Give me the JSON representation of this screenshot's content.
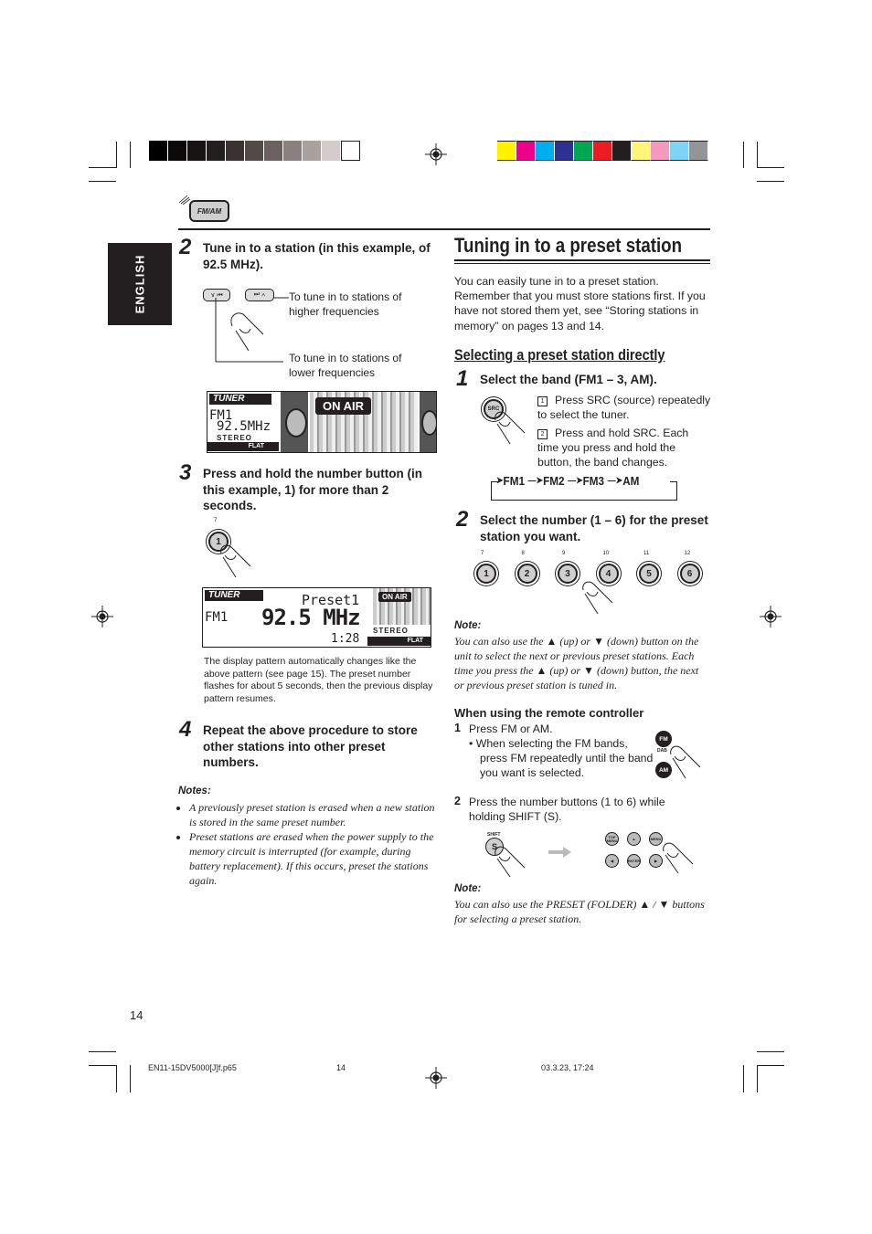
{
  "print_marks": {
    "grayscale_swatches": [
      "#000000",
      "#0b0908",
      "#171312",
      "#231f1e",
      "#3a3331",
      "#524a47",
      "#6b625f",
      "#8a817e",
      "#a9a19e",
      "#d3cccb",
      "#ffffff"
    ],
    "color_swatches": [
      "#fff200",
      "#ec008c",
      "#00aeef",
      "#2e3192",
      "#00a651",
      "#ed1c24",
      "#231f20",
      "#fff57a",
      "#f49ac1",
      "#7fd3f7",
      "#939598"
    ]
  },
  "side_tab": {
    "label": "ENGLISH"
  },
  "left": {
    "fm_am_button_label": "FM/AM",
    "step2": {
      "number": "2",
      "text": "Tune in to a station (in this example, of 92.5 MHz).",
      "button_down_label": "∨ ⏮",
      "button_up_label": "⏭ ∧",
      "higher_label": "To tune in to stations of higher frequencies",
      "lower_label": "To tune in to stations of lower frequencies",
      "display": {
        "tuner": "TUNER",
        "band": "FM1",
        "freq": "92.5MHz",
        "stereo": "STEREO",
        "eq": "FLAT",
        "on_air": "ON AIR"
      }
    },
    "step3": {
      "number": "3",
      "text": "Press and hold the number button (in this example, 1) for more than 2 seconds.",
      "button_sub": "7",
      "button_label": "1",
      "display": {
        "tuner": "TUNER",
        "band": "FM1",
        "freq": "92.5 MHz",
        "preset": "Preset1",
        "time": "1:28",
        "stereo": "STEREO",
        "eq": "FLAT",
        "on_air": "ON AIR"
      },
      "caption": "The display pattern automatically changes like the above pattern (see page 15). The preset number flashes for about 5 seconds, then the previous display pattern resumes."
    },
    "step4": {
      "number": "4",
      "text": "Repeat the above procedure to store other stations into other preset numbers."
    },
    "notes": {
      "heading": "Notes:",
      "items": [
        "A previously preset station is erased when a new station is stored in the same preset number.",
        "Preset stations are erased when the power supply to the memory circuit is interrupted (for example, during battery replacement). If this occurs, preset the stations again."
      ]
    }
  },
  "right": {
    "title": "Tuning in to a preset station",
    "intro": "You can easily tune in to a preset station. Remember that you must store stations first. If you have not stored them yet, see “Storing stations in memory” on pages 13 and 14.",
    "subheading": "Selecting a preset station directly",
    "step1": {
      "number": "1",
      "text": "Select the band (FM1 – 3, AM).",
      "src_label": "SRC",
      "sub_steps": [
        {
          "num": "1",
          "text": "Press SRC (source) repeatedly to select the tuner."
        },
        {
          "num": "2",
          "text": "Press and hold SRC. Each time you press and hold the button, the band changes."
        }
      ],
      "band_cycle": [
        "FM1",
        "FM2",
        "FM3",
        "AM"
      ]
    },
    "step2": {
      "number": "2",
      "text": "Select the number (1 – 6) for the preset station you want.",
      "buttons": [
        {
          "sub": "7",
          "label": "1"
        },
        {
          "sub": "8",
          "label": "2"
        },
        {
          "sub": "9",
          "label": "3"
        },
        {
          "sub": "10",
          "label": "4"
        },
        {
          "sub": "11",
          "label": "5"
        },
        {
          "sub": "12",
          "label": "6"
        }
      ]
    },
    "note1": {
      "heading": "Note:",
      "text": "You can also use the ▲ (up) or ▼ (down) button on the unit to select the next or previous preset stations. Each time you press the ▲ (up) or ▼ (down) button, the next or previous preset station is tuned in."
    },
    "remote": {
      "heading": "When using the remote controller",
      "step1_num": "1",
      "step1_text": "Press FM or AM.",
      "step1_bullet": "When selecting the FM bands, press FM repeatedly until the band you want is selected.",
      "fm_label": "FM",
      "dab_label": "DAB",
      "am_label": "AM",
      "step2_num": "2",
      "step2_text": "Press the number buttons (1 to 6) while holding SHIFT (S).",
      "shift_label": "SHIFT",
      "s_label": "S",
      "remote_buttons": [
        "TOP MENU",
        "▲",
        "MENU",
        "◀",
        "ENTER",
        "▶"
      ]
    },
    "note2": {
      "heading": "Note:",
      "text": "You can also use the PRESET (FOLDER) ▲ / ▼ buttons for selecting a preset station."
    }
  },
  "footer": {
    "page_number": "14",
    "file_name": "EN11-15DV5000[J]f.p65",
    "slug_page": "14",
    "timestamp": "03.3.23, 17:24"
  }
}
